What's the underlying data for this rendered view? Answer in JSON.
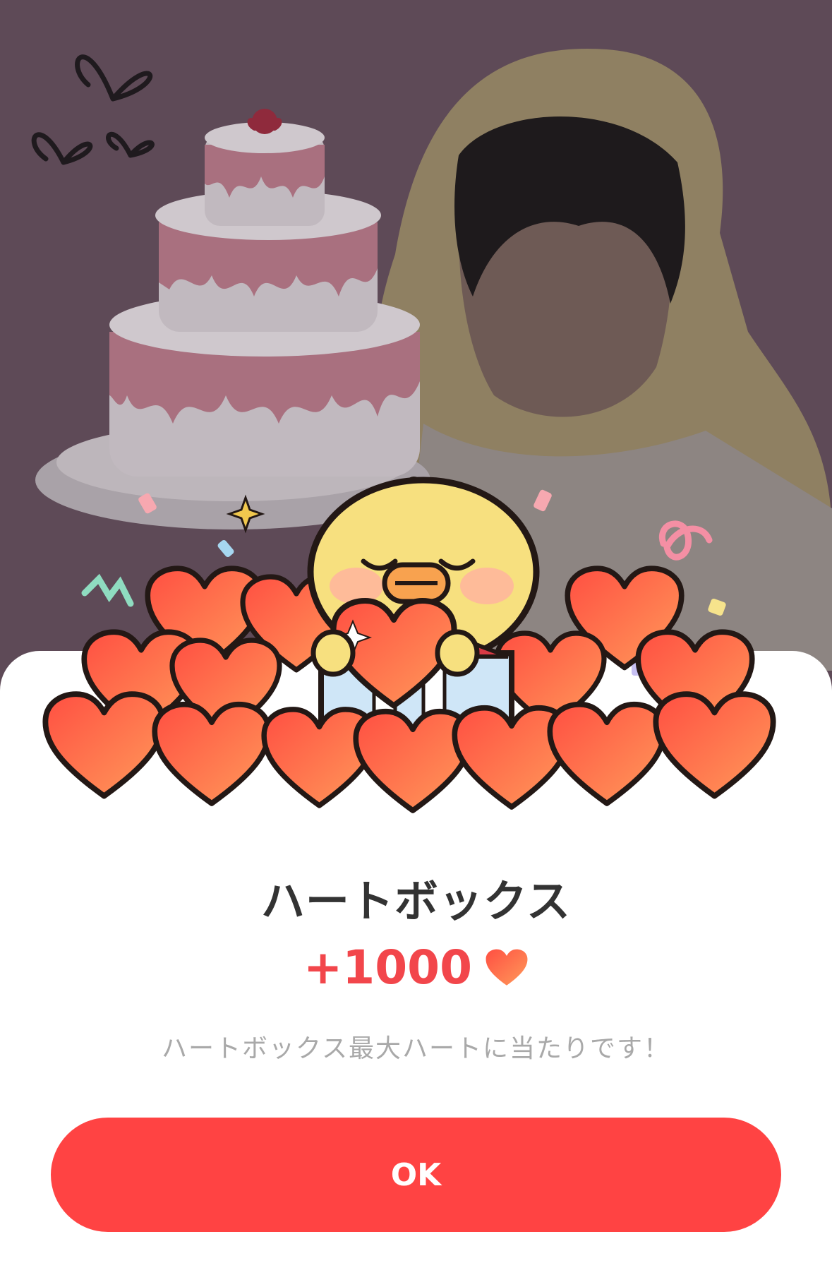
{
  "dialog": {
    "title": "ハートボックス",
    "reward_amount": "+1000",
    "reward_icon": "heart-icon",
    "message": "ハートボックス最大ハートに当たりです！",
    "ok_label": "OK"
  },
  "colors": {
    "background": "#5e4a57",
    "accent": "#ff4343",
    "title_text": "#333333",
    "reward_text": "#f2464b",
    "message_text": "#a9a9a9",
    "heart_fill": "#ff6a48"
  }
}
